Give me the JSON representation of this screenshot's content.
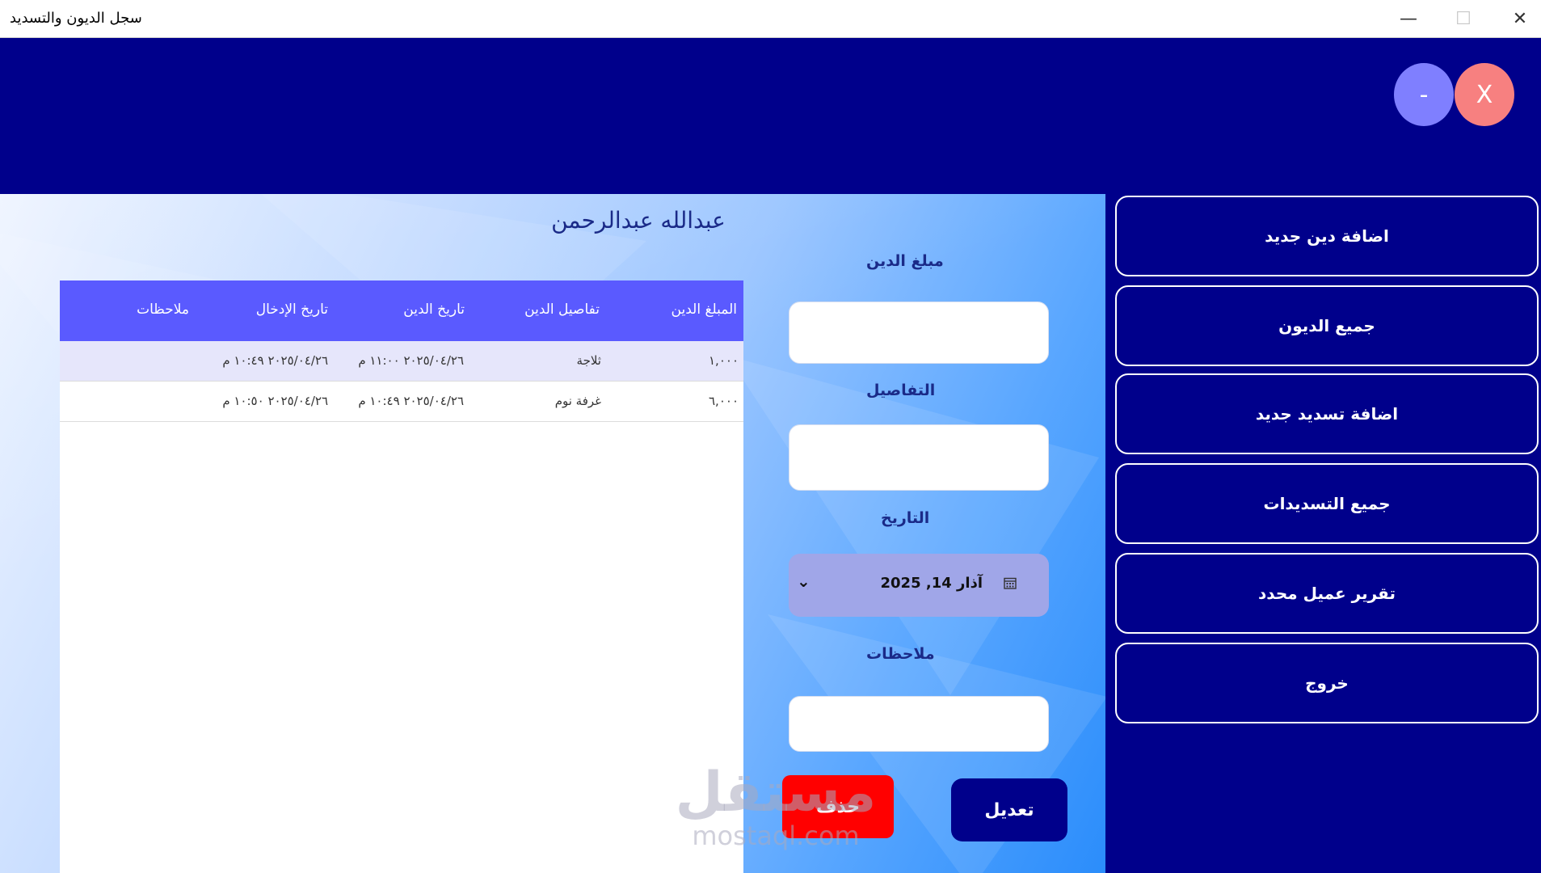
{
  "window": {
    "title": "سجل الديون والتسديد",
    "minimize_glyph": "—",
    "maximize_glyph": "☐",
    "close_glyph": "✕"
  },
  "app_controls": {
    "minimize_label": "-",
    "close_label": "X"
  },
  "customer": {
    "name": "عبدالله عبدالرحمن"
  },
  "table": {
    "columns": [
      "المبلغ الدين",
      "تفاصيل الدين",
      "تاريخ الدين",
      "تاريخ الإدخال",
      "ملاحظات"
    ],
    "rows": [
      [
        "١,٠٠٠",
        "ثلاجة",
        "٢٠٢٥/٠٤/٢٦ ١١:٠٠ م",
        "٢٠٢٥/٠٤/٢٦ ١٠:٤٩ م",
        ""
      ],
      [
        "٦,٠٠٠",
        "غرفة نوم",
        "٢٠٢٥/٠٤/٢٦ ١٠:٤٩ م",
        "٢٠٢٥/٠٤/٢٦ ١٠:٥٠ م",
        ""
      ]
    ]
  },
  "form": {
    "amount_label": "مبلغ الدين",
    "amount_value": "",
    "details_label": "التفاصيل",
    "details_value": "",
    "date_label": "التاريخ",
    "date_value": "آذار 14, 2025",
    "notes_label": "ملاحظات",
    "notes_value": "",
    "delete_label": "حذف",
    "edit_label": "تعديل"
  },
  "sidebar": {
    "items": [
      {
        "label": "اضافة دين جديد"
      },
      {
        "label": "جميع الديون"
      },
      {
        "label": "اضافة تسديد جديد"
      },
      {
        "label": "جميع التسديدات"
      },
      {
        "label": "تقرير عميل محدد"
      },
      {
        "label": "خروج"
      }
    ]
  },
  "watermark": {
    "arabic": "مستقل",
    "latin": "mostaql.com"
  },
  "colors": {
    "primary": "#00008b",
    "table_header": "#5a5aff",
    "delete": "#ff0000",
    "close_circle": "#f78080",
    "minimize_circle": "#7f7fff",
    "date_box": "#a0a6e8"
  }
}
